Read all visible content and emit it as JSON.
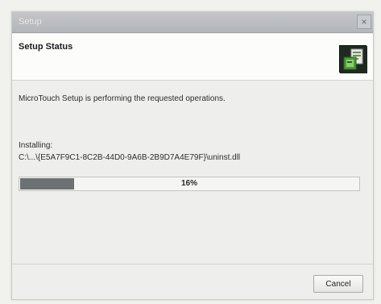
{
  "window": {
    "title": "Setup",
    "close_glyph": "×"
  },
  "header": {
    "heading": "Setup Status",
    "logo_icon": "setup-logo-icon"
  },
  "body": {
    "message": "MicroTouch Setup is performing the requested operations.",
    "installing_label": "Installing:",
    "installing_path": "C:\\...\\{E5A7F9C1-8C2B-44D0-9A6B-2B9D7A4E79F}\\uninst.dll",
    "progress": {
      "fraction": 0.16,
      "percent_text": "16%"
    }
  },
  "footer": {
    "cancel_label": "Cancel"
  }
}
